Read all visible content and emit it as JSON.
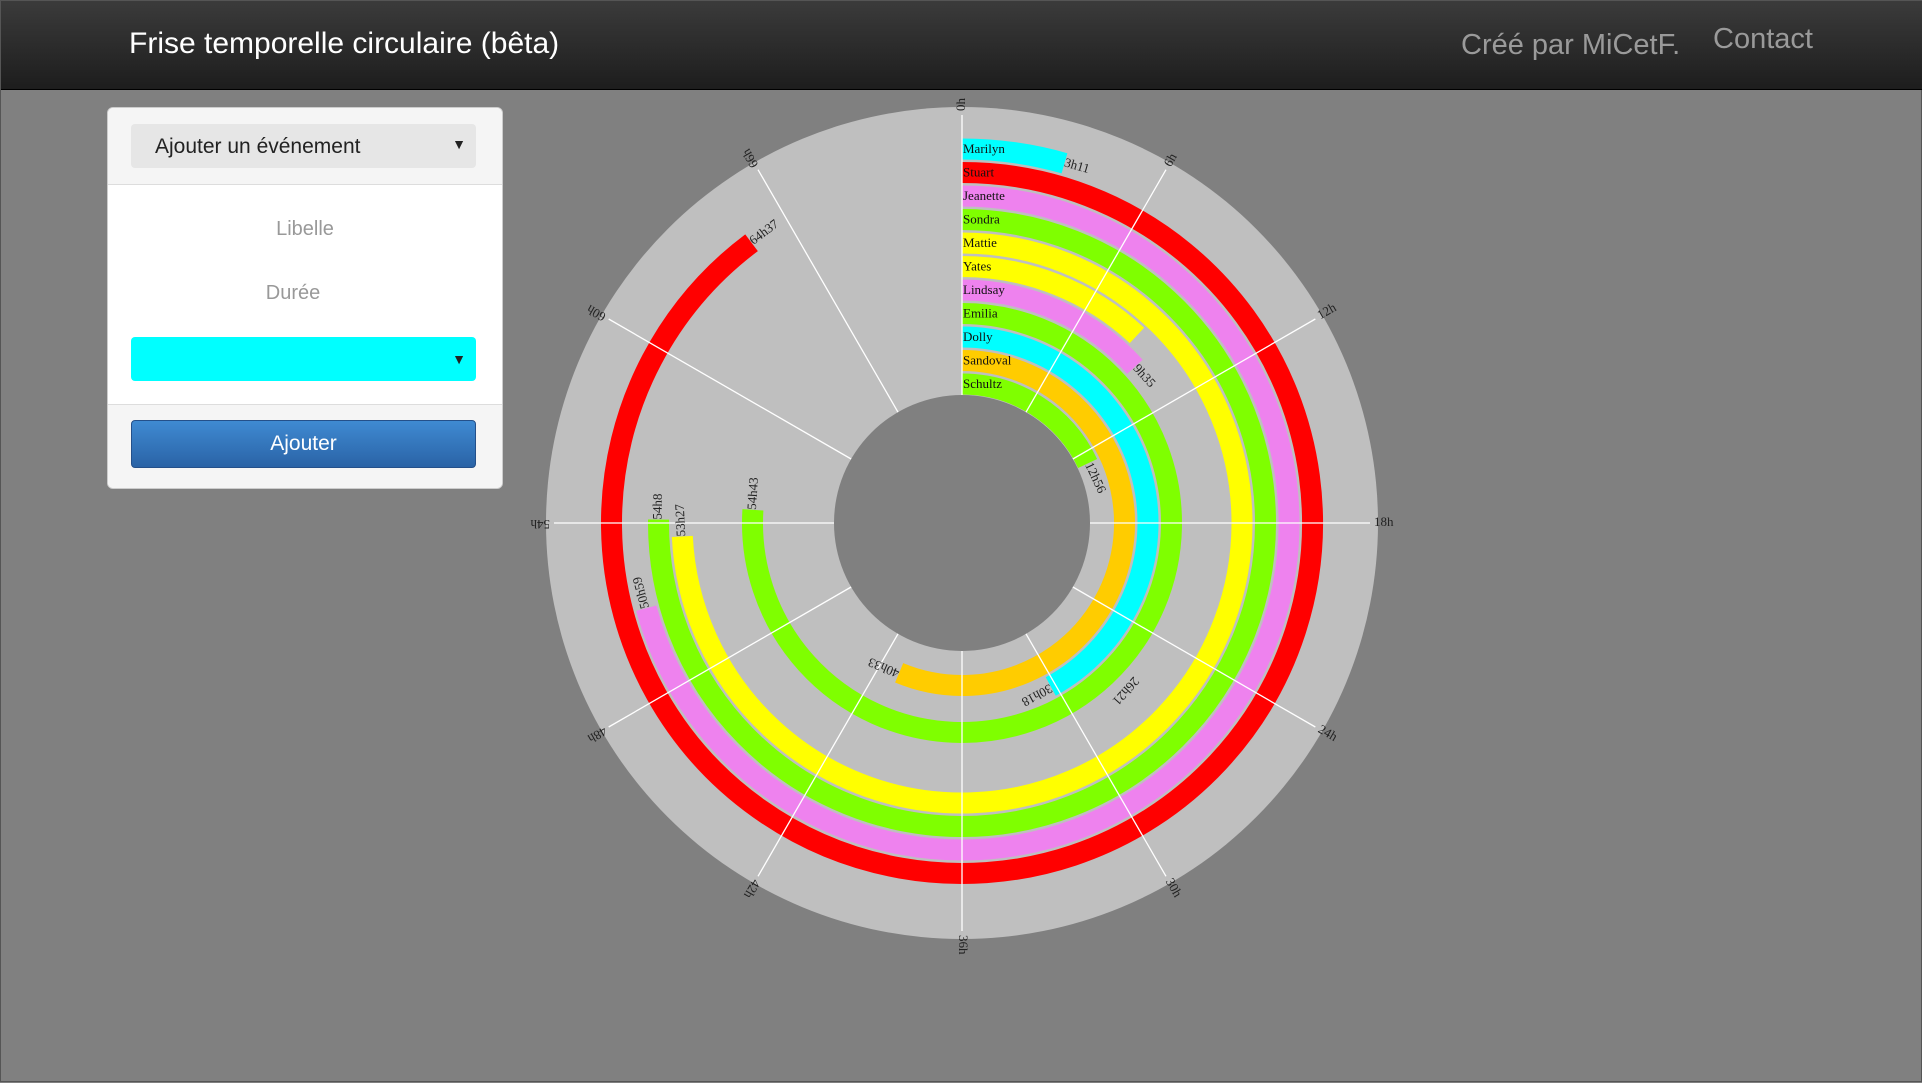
{
  "header": {
    "title": "Frise temporelle circulaire (bêta)",
    "credit": "Créé par MiCetF.",
    "contact": "Contact"
  },
  "form": {
    "type_select": "Ajouter un événement",
    "label_placeholder": "Libelle",
    "duration_placeholder": "Durée",
    "color_value": "#00ffff",
    "submit_label": "Ajouter"
  },
  "chart_data": {
    "type": "radial-timeline",
    "period_hours": 72,
    "hour_ticks": [
      "0h",
      "6h",
      "12h",
      "18h",
      "24h",
      "30h",
      "36h",
      "42h",
      "48h",
      "54h",
      "60h",
      "66h"
    ],
    "events": [
      {
        "name": "Marilyn",
        "end": "3h11",
        "hours": 3.18,
        "color": "#00ffff"
      },
      {
        "name": "Stuart",
        "end": "64h37",
        "hours": 64.62,
        "color": "#ff0000"
      },
      {
        "name": "Jeanette",
        "end": "50h59",
        "hours": 50.98,
        "color": "#ee82ee"
      },
      {
        "name": "Sondra",
        "end": "54h8",
        "hours": 54.13,
        "color": "#7fff00"
      },
      {
        "name": "Mattie",
        "end": "53h27",
        "hours": 53.45,
        "color": "#ffff00"
      },
      {
        "name": "Yates",
        "end": "",
        "hours": 8.6,
        "color": "#ffff00"
      },
      {
        "name": "Lindsay",
        "end": "9h35",
        "hours": 9.58,
        "color": "#ee82ee"
      },
      {
        "name": "Emilia",
        "end": "54h43",
        "hours": 54.72,
        "color": "#7fff00"
      },
      {
        "name": "Dolly",
        "end": "30h18",
        "hours": 30.3,
        "color": "#00ffff"
      },
      {
        "name": "Sandoval",
        "end": "40h33",
        "hours": 40.55,
        "color": "#ffcc00"
      },
      {
        "name": "Schultz",
        "end": "12h56",
        "hours": 12.93,
        "color": "#7fff00"
      }
    ],
    "extra_labels": [
      {
        "text": "26h21",
        "hours": 26.35,
        "ring": 6
      }
    ]
  }
}
